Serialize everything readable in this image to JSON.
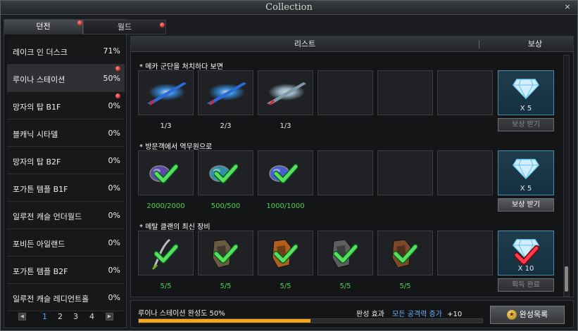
{
  "window": {
    "title": "Collection",
    "close_glyph": "×"
  },
  "tabs": [
    {
      "label": "던전"
    },
    {
      "label": "월드"
    }
  ],
  "dungeons": [
    {
      "name": "레이크 인 더스크",
      "pct": "71%",
      "selected": false,
      "alert": false
    },
    {
      "name": "루이나 스테이션",
      "pct": "50%",
      "selected": true,
      "alert": true
    },
    {
      "name": "망자의 탑 B1F",
      "pct": "0%",
      "selected": false,
      "alert": true
    },
    {
      "name": "블캐닉 시타델",
      "pct": "0%",
      "selected": false,
      "alert": false
    },
    {
      "name": "망자의 탑 B2F",
      "pct": "0%",
      "selected": false,
      "alert": false
    },
    {
      "name": "포가튼 템플 B1F",
      "pct": "0%",
      "selected": false,
      "alert": false
    },
    {
      "name": "일루전 캐슬 언더월드",
      "pct": "0%",
      "selected": false,
      "alert": false
    },
    {
      "name": "포비든 아일랜드",
      "pct": "0%",
      "selected": false,
      "alert": false
    },
    {
      "name": "포가튼 템플 B2F",
      "pct": "0%",
      "selected": false,
      "alert": false
    },
    {
      "name": "일루전 캐슬 레디언트홀",
      "pct": "0%",
      "selected": false,
      "alert": false
    }
  ],
  "pager": {
    "prev": "◀",
    "next": "▶",
    "pages": [
      "1",
      "2",
      "3",
      "4"
    ],
    "current": "1"
  },
  "header": {
    "list": "리스트",
    "reward": "보상"
  },
  "sections": [
    {
      "title": "메카 군단을 처치하다 보면",
      "items": [
        {
          "icon": "blue-sword-icon",
          "count": "1/3",
          "complete": false
        },
        {
          "icon": "blue-sword-icon",
          "count": "2/3",
          "complete": false
        },
        {
          "icon": "silver-sword-icon",
          "count": "1/3",
          "complete": false
        }
      ],
      "reward": {
        "icon": "diamond-icon",
        "qty": "X 5",
        "button": "보상 받기",
        "enabled": false,
        "checked": false
      }
    },
    {
      "title": "방문객에서 역무원으로",
      "items": [
        {
          "icon": "purple-orb-icon",
          "count": "2000/2000",
          "complete": true
        },
        {
          "icon": "cyan-orb-icon",
          "count": "500/500",
          "complete": true
        },
        {
          "icon": "blue-orb-icon",
          "count": "1000/1000",
          "complete": true
        }
      ],
      "reward": {
        "icon": "diamond-icon",
        "qty": "X 5",
        "button": "보상 받기",
        "enabled": true,
        "checked": false
      }
    },
    {
      "title": "메탈 클랜의 최신 장비",
      "items": [
        {
          "icon": "blade-icon",
          "count": "5/5",
          "complete": true
        },
        {
          "icon": "gauntlet-icon",
          "count": "5/5",
          "complete": true
        },
        {
          "icon": "armor-icon",
          "count": "5/5",
          "complete": true
        },
        {
          "icon": "glove-icon",
          "count": "5/5",
          "complete": true
        },
        {
          "icon": "boot-icon",
          "count": "5/5",
          "complete": true
        }
      ],
      "reward": {
        "icon": "diamond-icon",
        "qty": "X 10",
        "button": "획득 완료",
        "enabled": false,
        "checked": true
      }
    }
  ],
  "progress": {
    "label": "루이나 스테이션 완성도 50%",
    "value": 0.5
  },
  "effect": {
    "label": "완성 효과",
    "value": "모든 공격력 증가",
    "amount": "+10"
  },
  "complete_button": {
    "label": "완성목록"
  },
  "colors": {
    "progress": "#f2a81a",
    "link": "#6fb2ff",
    "complete_text": "#52d452"
  }
}
